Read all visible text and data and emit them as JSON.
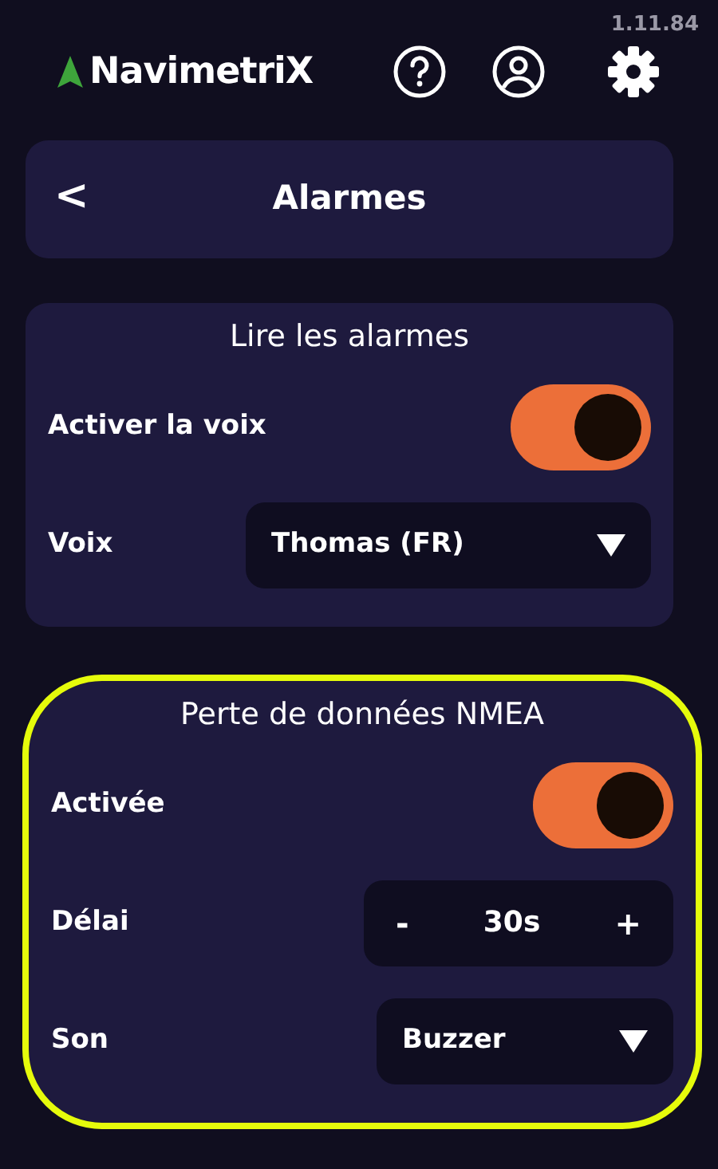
{
  "version": "1.11.84",
  "app": {
    "name": "NavimetriX"
  },
  "page": {
    "title": "Alarmes",
    "back": "<"
  },
  "sections": [
    {
      "title": "Lire les alarmes",
      "highlighted": false,
      "rows": [
        {
          "kind": "toggle",
          "label": "Activer la voix",
          "on": true
        },
        {
          "kind": "select",
          "label": "Voix",
          "value": "Thomas (FR)"
        }
      ]
    },
    {
      "title": "Perte de données NMEA",
      "highlighted": true,
      "rows": [
        {
          "kind": "toggle",
          "label": "Activée",
          "on": true
        },
        {
          "kind": "stepper",
          "label": "Délai",
          "minus": "-",
          "value": "30s",
          "plus": "+"
        },
        {
          "kind": "select",
          "label": "Son",
          "value": "Buzzer"
        }
      ]
    }
  ]
}
